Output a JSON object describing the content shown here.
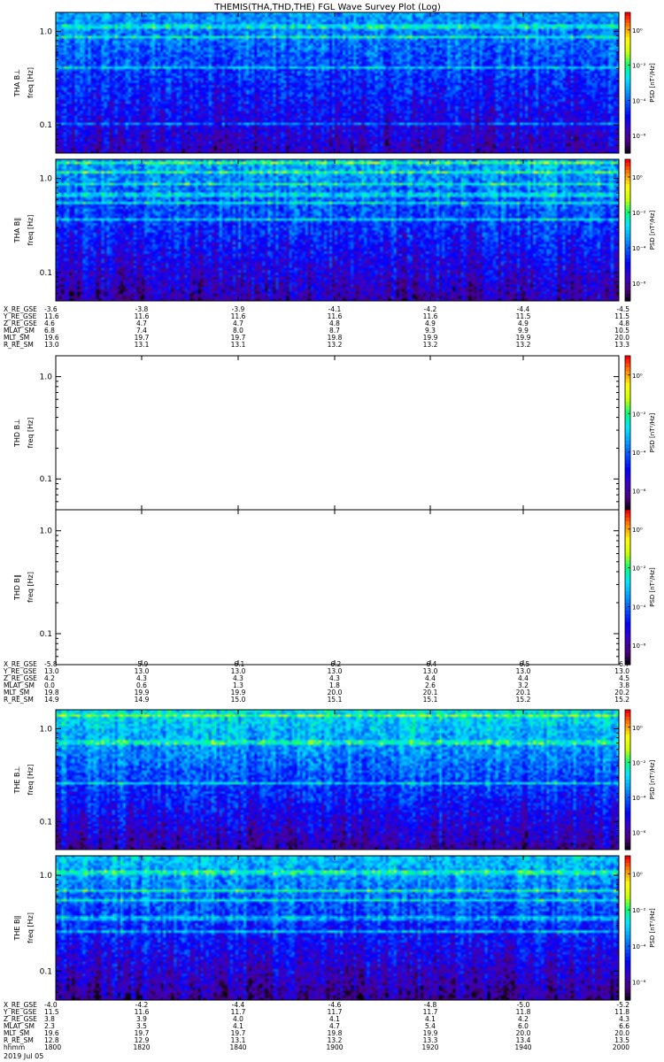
{
  "title": "THEMIS(THA,THD,THE) FGL Wave Survey Plot (Log)",
  "colorbar_label": "PSD [nT²/Hz]",
  "colorbar_ticks": [
    "10⁰",
    "10⁻²",
    "10⁻⁴",
    "10⁻⁶"
  ],
  "freq_ticks": [
    "1.0",
    "0.1"
  ],
  "colors": {
    "colormap": [
      "#000000",
      "#4b007d",
      "#3c00c8",
      "#0000ff",
      "#0050ff",
      "#00a0ff",
      "#00e6ff",
      "#00ff78",
      "#c8ff00",
      "#ffff00",
      "#ff8c00",
      "#ff0000"
    ],
    "frame": "#000000"
  },
  "chart_data": [
    {
      "type": "heatmap",
      "panel": "THA BL",
      "ylabel_line1": "THA B⊥",
      "ylabel_line2": "freq [Hz]",
      "yscale": "log",
      "ylim": [
        0.05,
        1.6
      ],
      "zscale": "log",
      "zlim": [
        1e-07,
        10
      ],
      "empty": false,
      "bright_bands_hz": [
        1.15,
        0.9,
        0.42,
        0.1
      ],
      "background_level": [
        -3.4,
        -5.6
      ]
    },
    {
      "type": "heatmap",
      "panel": "THA BII",
      "ylabel_line1": "THA B∥",
      "ylabel_line2": "freq [Hz]",
      "yscale": "log",
      "ylim": [
        0.05,
        1.6
      ],
      "zscale": "log",
      "zlim": [
        1e-07,
        10
      ],
      "empty": false,
      "bright_bands_hz": [
        1.5,
        1.2,
        0.9,
        0.68,
        0.55,
        0.37
      ],
      "background_level": [
        -3.2,
        -5.8
      ]
    },
    {
      "type": "heatmap",
      "panel": "THD BL",
      "ylabel_line1": "THD B⊥",
      "ylabel_line2": "freq [Hz]",
      "yscale": "log",
      "ylim": [
        0.05,
        1.6
      ],
      "zscale": "log",
      "zlim": [
        1e-07,
        10
      ],
      "empty": true
    },
    {
      "type": "heatmap",
      "panel": "THD BII",
      "ylabel_line1": "THD B∥",
      "ylabel_line2": "freq [Hz]",
      "yscale": "log",
      "ylim": [
        0.05,
        1.6
      ],
      "zscale": "log",
      "zlim": [
        1e-07,
        10
      ],
      "empty": true
    },
    {
      "type": "heatmap",
      "panel": "THE BL",
      "ylabel_line1": "THE B⊥",
      "ylabel_line2": "freq [Hz]",
      "yscale": "log",
      "ylim": [
        0.05,
        1.6
      ],
      "zscale": "log",
      "zlim": [
        1e-07,
        10
      ],
      "empty": false,
      "bright_bands_hz": [
        1.4,
        0.72,
        0.26
      ],
      "background_level": [
        -2.6,
        -5.8
      ]
    },
    {
      "type": "heatmap",
      "panel": "THE BII",
      "ylabel_line1": "THE B∥",
      "ylabel_line2": "freq [Hz]",
      "yscale": "log",
      "ylim": [
        0.05,
        1.6
      ],
      "zscale": "log",
      "zlim": [
        1e-07,
        10
      ],
      "empty": false,
      "bright_bands_hz": [
        1.1,
        0.7,
        0.55,
        0.36,
        0.26
      ],
      "background_level": [
        -3.0,
        -6.0
      ]
    }
  ],
  "ephemeris_tables": [
    {
      "labels": [
        "X_RE_GSE",
        "Y_RE_GSE",
        "Z_RE_GSE",
        "MLAT_SM",
        "MLT_SM",
        "R_RE_SM"
      ],
      "rows": [
        [
          "-3.6",
          "-3.8",
          "-3.9",
          "-4.1",
          "-4.2",
          "-4.4",
          "-4.5"
        ],
        [
          "11.6",
          "11.6",
          "11.6",
          "11.6",
          "11.6",
          "11.5",
          "11.5"
        ],
        [
          "4.6",
          "4.7",
          "4.7",
          "4.8",
          "4.9",
          "4.9",
          "4.8"
        ],
        [
          "6.8",
          "7.4",
          "8.0",
          "8.7",
          "9.3",
          "9.9",
          "10.5"
        ],
        [
          "19.6",
          "19.7",
          "19.7",
          "19.8",
          "19.9",
          "19.9",
          "20.0"
        ],
        [
          "13.0",
          "13.1",
          "13.1",
          "13.2",
          "13.2",
          "13.2",
          "13.3"
        ]
      ]
    },
    {
      "labels": [
        "X_RE_GSE",
        "Y_RE_GSE",
        "Z_RE_GSE",
        "MLAT_SM",
        "MLT_SM",
        "R_RE_SM"
      ],
      "rows": [
        [
          "-5.8",
          "-5.9",
          "-6.1",
          "-6.2",
          "-6.4",
          "-6.5",
          "-6.7"
        ],
        [
          "13.0",
          "13.0",
          "13.0",
          "13.0",
          "13.0",
          "13.0",
          "13.0"
        ],
        [
          "4.2",
          "4.3",
          "4.3",
          "4.3",
          "4.4",
          "4.4",
          "4.5"
        ],
        [
          "0.0",
          "0.6",
          "1.3",
          "1.8",
          "2.6",
          "3.2",
          "3.8"
        ],
        [
          "19.8",
          "19.9",
          "19.9",
          "20.0",
          "20.1",
          "20.1",
          "20.2"
        ],
        [
          "14.9",
          "14.9",
          "15.0",
          "15.1",
          "15.1",
          "15.2",
          "15.2"
        ]
      ]
    },
    {
      "labels": [
        "X_RE_GSE",
        "Y_RE_GSE",
        "Z_RE_GSE",
        "MLAT_SM",
        "MLT_SM",
        "R_RE_SM",
        "hhmm"
      ],
      "rows": [
        [
          "-4.0",
          "-4.2",
          "-4.4",
          "-4.6",
          "-4.8",
          "-5.0",
          "-5.2"
        ],
        [
          "11.5",
          "11.6",
          "11.7",
          "11.7",
          "11.7",
          "11.8",
          "11.8"
        ],
        [
          "3.8",
          "3.9",
          "4.0",
          "4.1",
          "4.1",
          "4.2",
          "4.3"
        ],
        [
          "2.3",
          "3.5",
          "4.1",
          "4.7",
          "5.4",
          "6.0",
          "6.6"
        ],
        [
          "19.6",
          "19.7",
          "19.7",
          "19.8",
          "19.9",
          "20.0",
          "20.0"
        ],
        [
          "12.8",
          "12.9",
          "13.1",
          "13.2",
          "13.3",
          "13.4",
          "13.5"
        ],
        [
          "1800",
          "1820",
          "1840",
          "1900",
          "1920",
          "1940",
          "2000"
        ]
      ]
    }
  ],
  "date_label": "2019 Jul 05"
}
